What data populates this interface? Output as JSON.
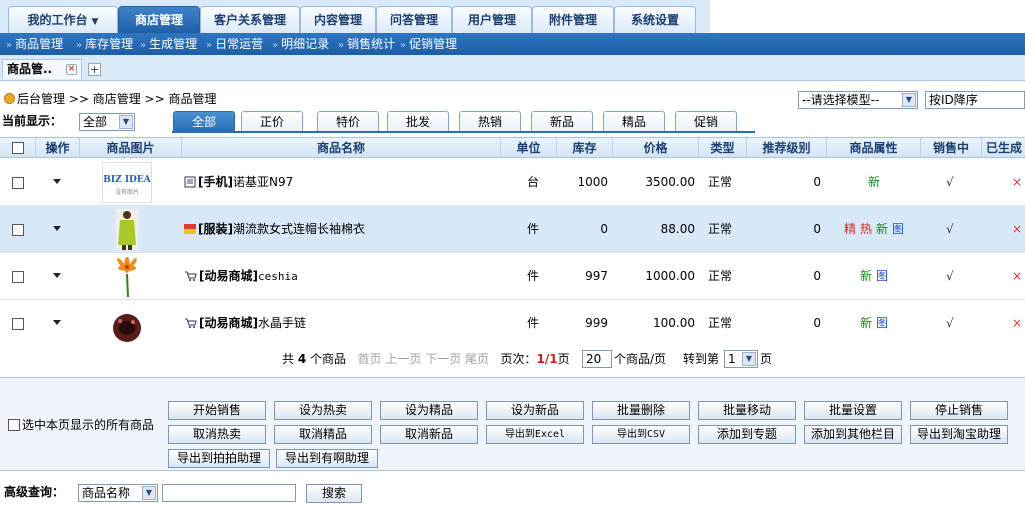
{
  "top_tabs": [
    {
      "label": "我的工作台",
      "caret": "▼"
    },
    {
      "label": "商店管理"
    },
    {
      "label": "客户关系管理"
    },
    {
      "label": "内容管理"
    },
    {
      "label": "问答管理"
    },
    {
      "label": "用户管理"
    },
    {
      "label": "附件管理"
    },
    {
      "label": "系统设置"
    }
  ],
  "sub_nav": [
    "商品管理",
    "库存管理",
    "生成管理",
    "日常运营",
    "明细记录",
    "销售统计",
    "促销管理"
  ],
  "doc_tab": {
    "label": "商品管..",
    "close": "×",
    "add": "+"
  },
  "breadcrumb": "后台管理 >> 商店管理 >> 商品管理",
  "model_select": {
    "value": "--请选择模型--"
  },
  "sort_select": {
    "value": "按ID降序"
  },
  "filter": {
    "label": "当前显示：",
    "select_value": "全部",
    "tabs": [
      "全部",
      "正价",
      "特价",
      "批发",
      "热销",
      "新品",
      "精品",
      "促销"
    ]
  },
  "table": {
    "headers": [
      "操作",
      "商品图片",
      "商品名称",
      "单位",
      "库存",
      "价格",
      "类型",
      "推荐级别",
      "商品属性",
      "销售中",
      "已生成"
    ],
    "rows": [
      {
        "category": "[手机]",
        "name": "诺基亚N97",
        "unit": "台",
        "stock": "1000",
        "price": "3500.00",
        "type": "正常",
        "level": "0",
        "attrs": [
          "新"
        ],
        "on_sale": "√",
        "generated": "×",
        "thumb_text": "BIZ IDEA",
        "thumb_sub": "没有图片"
      },
      {
        "category": "[服装]",
        "name": "潮流款女式连帽长袖棉衣",
        "unit": "件",
        "stock": "0",
        "price": "88.00",
        "type": "正常",
        "level": "0",
        "attrs": [
          "精",
          "热",
          "新",
          "图"
        ],
        "on_sale": "√",
        "generated": "×"
      },
      {
        "category": "[动易商城]",
        "name": "ceshia",
        "unit": "件",
        "stock": "997",
        "price": "1000.00",
        "type": "正常",
        "level": "0",
        "attrs": [
          "新",
          "图"
        ],
        "on_sale": "√",
        "generated": "×"
      },
      {
        "category": "[动易商城]",
        "name": "水晶手链",
        "unit": "件",
        "stock": "999",
        "price": "100.00",
        "type": "正常",
        "level": "0",
        "attrs": [
          "新",
          "图"
        ],
        "on_sale": "√",
        "generated": "×"
      }
    ]
  },
  "pager": {
    "total_prefix": "共",
    "total": "4",
    "total_suffix": "个商品",
    "first": "首页",
    "prev": "上一页",
    "next": "下一页",
    "last": "尾页",
    "page_label": "页次：",
    "page": "1/1",
    "page_unit": "页",
    "per_page": "20",
    "per_page_suffix": "个商品/页",
    "goto_prefix": "转到第",
    "goto_value": "1",
    "goto_suffix": "页"
  },
  "batch": {
    "select_all": "选中本页显示的所有商品",
    "buttons_row1": [
      "开始销售",
      "设为热卖",
      "设为精品",
      "设为新品",
      "批量删除",
      "批量移动",
      "批量设置",
      "停止销售"
    ],
    "buttons_row2": [
      "取消热卖",
      "取消精品",
      "取消新品",
      "导出到Excel",
      "导出到CSV",
      "添加到专题",
      "添加到其他栏目",
      "导出到淘宝助理"
    ],
    "buttons_row3": [
      "导出到拍拍助理",
      "导出到有啊助理"
    ]
  },
  "advanced_search": {
    "label": "高级查询：",
    "field_value": "商品名称",
    "search_button": "搜索"
  }
}
